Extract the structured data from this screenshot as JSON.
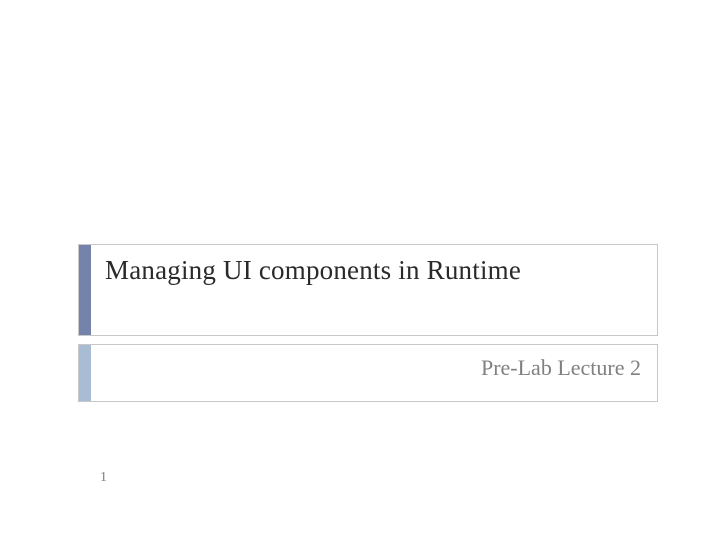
{
  "slide": {
    "title": "Managing UI components in Runtime",
    "subtitle": "Pre-Lab Lecture 2",
    "page_number": "1"
  },
  "colors": {
    "title_accent": "#7583ab",
    "subtitle_accent": "#a8bcd4",
    "border": "#c8c8c8",
    "subtitle_text": "#808080"
  }
}
